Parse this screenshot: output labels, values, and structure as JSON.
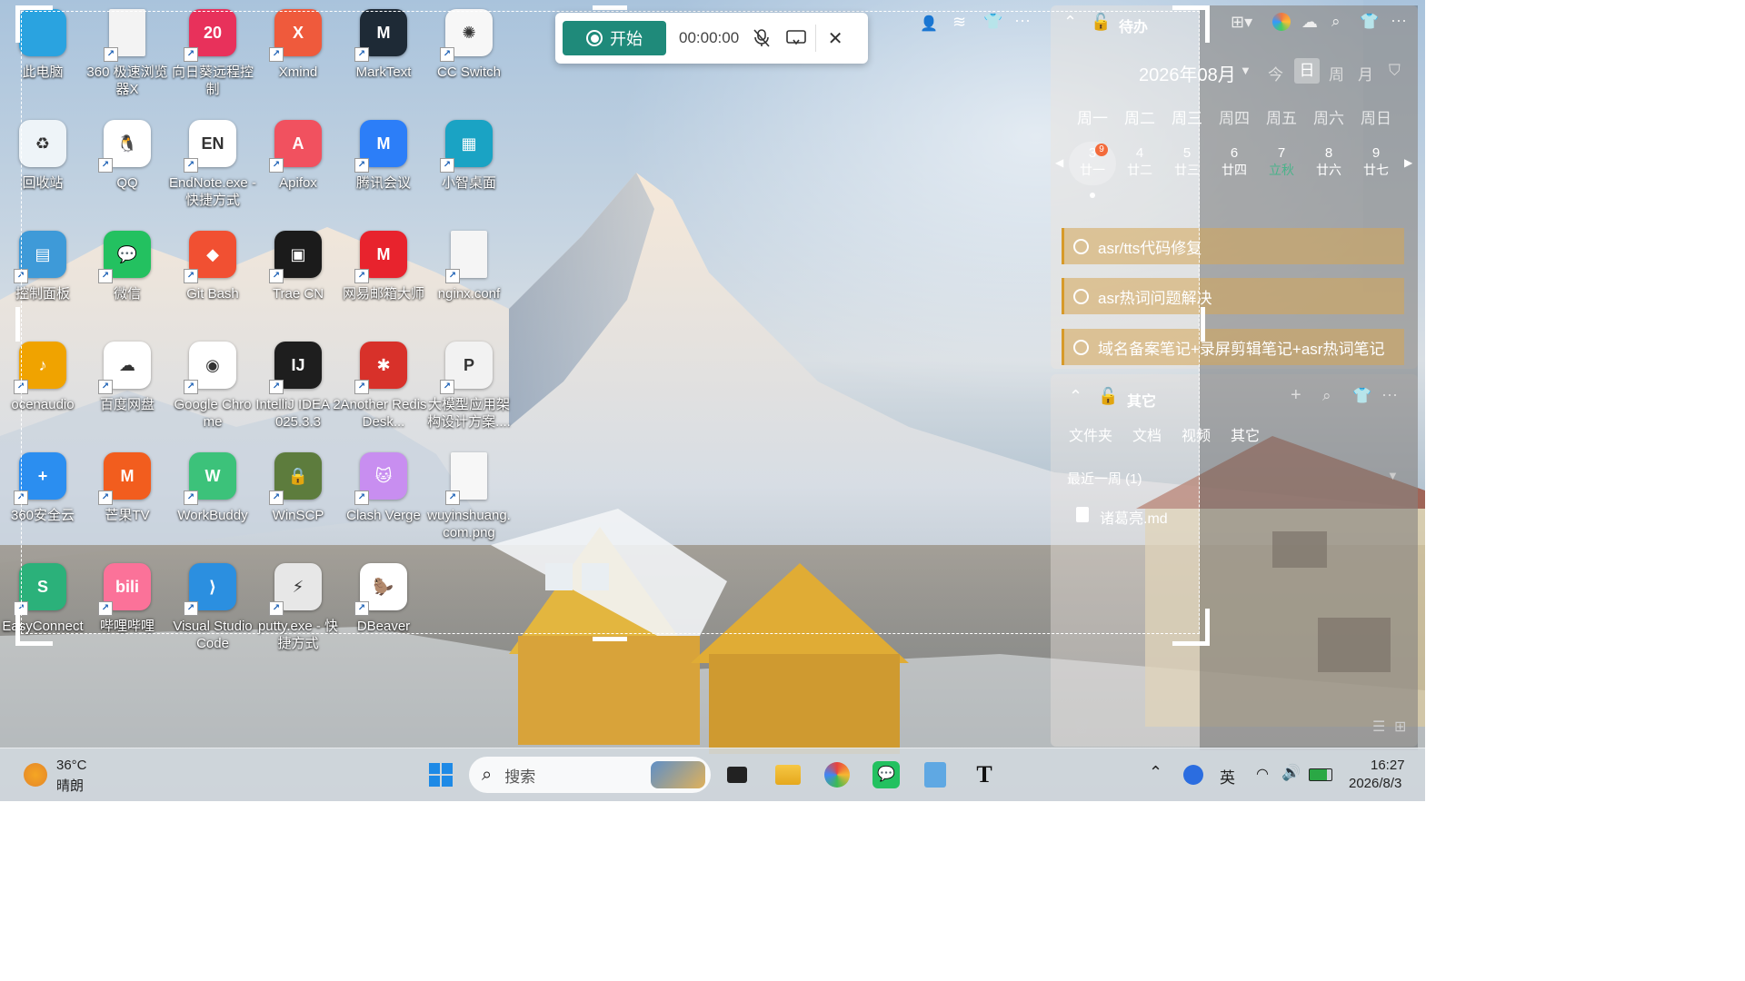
{
  "desktop": {
    "icons": [
      {
        "label": "此电脑",
        "icon": "computer-icon",
        "color": "#2aa3e0",
        "glyph": ""
      },
      {
        "label": "360 极速浏览器X",
        "icon": "file-icon",
        "color": "#f3f3f3",
        "glyph": ""
      },
      {
        "label": "向日葵远程控制",
        "icon": "sunflower-icon",
        "color": "#e8315b",
        "glyph": "20"
      },
      {
        "label": "Xmind",
        "icon": "xmind-icon",
        "color": "#ef5a3c",
        "glyph": "X"
      },
      {
        "label": "MarkText",
        "icon": "marktext-icon",
        "color": "#1e2a36",
        "glyph": "M"
      },
      {
        "label": "CC Switch",
        "icon": "cc-switch-icon",
        "color": "#f7f7f7",
        "glyph": "✺"
      },
      {
        "label": "回收站",
        "icon": "recycle-bin-icon",
        "color": "#eef4f8",
        "glyph": "♻"
      },
      {
        "label": "QQ",
        "icon": "qq-icon",
        "color": "#ffffff",
        "glyph": "🐧"
      },
      {
        "label": "EndNote.exe - 快捷方式",
        "icon": "endnote-icon",
        "color": "#ffffff",
        "glyph": "EN"
      },
      {
        "label": "Apifox",
        "icon": "apifox-icon",
        "color": "#f1515f",
        "glyph": "A"
      },
      {
        "label": "腾讯会议",
        "icon": "tencent-meeting-icon",
        "color": "#2c7ef8",
        "glyph": "M"
      },
      {
        "label": "小智桌面",
        "icon": "xiaozhi-desktop-icon",
        "color": "#1aa3c4",
        "glyph": "▦"
      },
      {
        "label": "控制面板",
        "icon": "control-panel-icon",
        "color": "#3e9ad8",
        "glyph": "▤"
      },
      {
        "label": "微信",
        "icon": "wechat-icon",
        "color": "#23c160",
        "glyph": "💬"
      },
      {
        "label": "Git Bash",
        "icon": "git-bash-icon",
        "color": "#f15032",
        "glyph": "◆"
      },
      {
        "label": "Trae CN",
        "icon": "trae-icon",
        "color": "#1b1b1b",
        "glyph": "▣"
      },
      {
        "label": "网易邮箱大师",
        "icon": "netease-mail-icon",
        "color": "#e8232d",
        "glyph": "M"
      },
      {
        "label": "nginx.conf",
        "icon": "file-icon",
        "color": "#f5f5f5",
        "glyph": ""
      },
      {
        "label": "ocenaudio",
        "icon": "ocenaudio-icon",
        "color": "#f0a300",
        "glyph": "♪"
      },
      {
        "label": "百度网盘",
        "icon": "baidu-netdisk-icon",
        "color": "#ffffff",
        "glyph": "☁"
      },
      {
        "label": "Google Chrome",
        "icon": "chrome-icon",
        "color": "#ffffff",
        "glyph": "◉"
      },
      {
        "label": "IntelliJ IDEA 2025.3.3",
        "icon": "intellij-icon",
        "color": "#1e1e1e",
        "glyph": "IJ"
      },
      {
        "label": "Another Redis Desk...",
        "icon": "redis-icon",
        "color": "#d8312a",
        "glyph": "✱"
      },
      {
        "label": "大模型应用架构设计方案....",
        "icon": "ppt-file-icon",
        "color": "#f2f2f2",
        "glyph": "P"
      },
      {
        "label": "360安全云",
        "icon": "360-cloud-icon",
        "color": "#2b8ef0",
        "glyph": "+"
      },
      {
        "label": "芒果TV",
        "icon": "mango-tv-icon",
        "color": "#f25d1e",
        "glyph": "M"
      },
      {
        "label": "WorkBuddy",
        "icon": "workbuddy-icon",
        "color": "#3cc27a",
        "glyph": "W"
      },
      {
        "label": "WinSCP",
        "icon": "winscp-icon",
        "color": "#5d7c3d",
        "glyph": "🔒"
      },
      {
        "label": "Clash Verge",
        "icon": "clash-verge-icon",
        "color": "#c88ef0",
        "glyph": "🐱"
      },
      {
        "label": "wuyinshuang.com.png",
        "icon": "image-file-icon",
        "color": "#f7f7f7",
        "glyph": ""
      },
      {
        "label": "EasyConnect",
        "icon": "easyconnect-icon",
        "color": "#2bb17a",
        "glyph": "S"
      },
      {
        "label": "哔哩哔哩",
        "icon": "bilibili-icon",
        "color": "#fb7299",
        "glyph": "bili"
      },
      {
        "label": "Visual Studio Code",
        "icon": "vscode-icon",
        "color": "#2b8fe0",
        "glyph": "⟩"
      },
      {
        "label": "putty.exe - 快捷方式",
        "icon": "putty-icon",
        "color": "#e7e7e7",
        "glyph": "⚡"
      },
      {
        "label": "DBeaver",
        "icon": "dbeaver-icon",
        "color": "#ffffff",
        "glyph": "🦫"
      }
    ]
  },
  "recorder": {
    "start_label": "开始",
    "timer": "00:00:00"
  },
  "todo_widget": {
    "title": "待办",
    "month_label": "2026年08月",
    "view_today": "今",
    "view_day": "日",
    "view_week": "周",
    "view_month": "月",
    "weekdays": [
      "周一",
      "周二",
      "周三",
      "周四",
      "周五",
      "周六",
      "周日"
    ],
    "days": [
      {
        "num": "3",
        "lunar": "廿一",
        "badge": "9"
      },
      {
        "num": "4",
        "lunar": "廿二"
      },
      {
        "num": "5",
        "lunar": "廿三"
      },
      {
        "num": "6",
        "lunar": "廿四"
      },
      {
        "num": "7",
        "lunar": "立秋"
      },
      {
        "num": "8",
        "lunar": "廿六"
      },
      {
        "num": "9",
        "lunar": "廿七"
      }
    ],
    "items": [
      "asr/tts代码修复",
      "asr热词问题解决",
      "域名备案笔记+录屏剪辑笔记+asr热词笔记"
    ]
  },
  "files_widget": {
    "title": "其它",
    "tabs": [
      "文件夹",
      "文档",
      "视频",
      "其它"
    ],
    "group": "最近一周 (1)",
    "file": "诸葛亮.md"
  },
  "taskbar": {
    "weather_temp": "36°C",
    "weather_desc": "晴朗",
    "search_placeholder": "搜索",
    "ime": "英",
    "time": "16:27",
    "date": "2026/8/3"
  }
}
